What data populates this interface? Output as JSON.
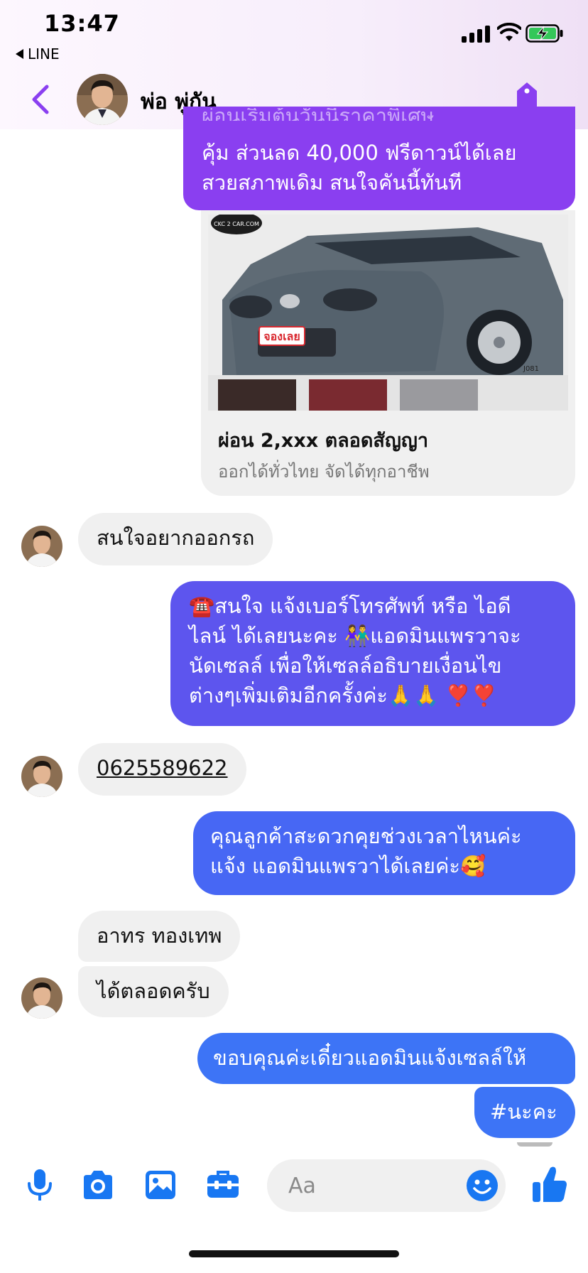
{
  "status_bar": {
    "time": "13:47",
    "back_app": "LINE"
  },
  "header": {
    "contact_name": "พ่อ พู่กัน"
  },
  "messages": {
    "out_1": {
      "clipped_line": "ผ่อนเริ่มต้นวันนี้ราคาพิเศษ",
      "lines": [
        "คุ้ม ส่วนลด 40,000 ฟรีดาวน์ได้เลย",
        "สวยสภาพเดิม สนใจคันนี้ทันที"
      ]
    },
    "link_card": {
      "image_label": "จองเลย",
      "image_logo": "CKC 2 CAR.COM",
      "image_code": "J081",
      "title": "ผ่อน 2,xxx ตลอดสัญญา",
      "subtitle": "ออกได้ทั่วไทย จัดได้ทุกอาชีพ"
    },
    "in_1": "สนใจอยากออกรถ",
    "out_2": {
      "lines": [
        "☎️สนใจ แจ้งเบอร์โทรศัพท์ หรือ ไอดี",
        "ไลน์  ได้เลยนะคะ 👫แอดมินแพรวาจะ",
        "นัดเซลล์     เพื่อให้เซลล์อธิบายเงื่อนไข",
        "ต่างๆเพิ่มเติมอีกครั้งค่ะ🙏🙏 ❣️❣️"
      ]
    },
    "in_2": "0625589622",
    "out_3": {
      "lines": [
        "คุณลูกค้าสะดวกคุยช่วงเวลาไหนค่ะ",
        "แจ้ง แอดมินแพรวาได้เลยค่ะ🥰"
      ]
    },
    "in_3": "อาทร ทองเทพ",
    "in_4": "ได้ตลอดครับ",
    "out_4": "ขอบคุณค่ะเดี๋ยวแอดมินแจ้งเซลล์ให้",
    "out_5": "#นะคะ"
  },
  "composer": {
    "placeholder": "Aa"
  },
  "colors": {
    "accent": "#8a3ff0",
    "bubble_out_purple": "#8a3ff0",
    "bubble_out_indigo": "#5d55ee",
    "bubble_out_blue": "#3d74f6",
    "bubble_in": "#f0f0f0",
    "icon_blue": "#1877f2"
  },
  "icons": {
    "back": "chevron-left-icon",
    "tag": "tag-icon",
    "mic": "mic-icon",
    "camera": "camera-icon",
    "gallery": "gallery-icon",
    "toolbox": "toolbox-icon",
    "emoji": "emoji-icon",
    "like": "thumbs-up-icon"
  }
}
